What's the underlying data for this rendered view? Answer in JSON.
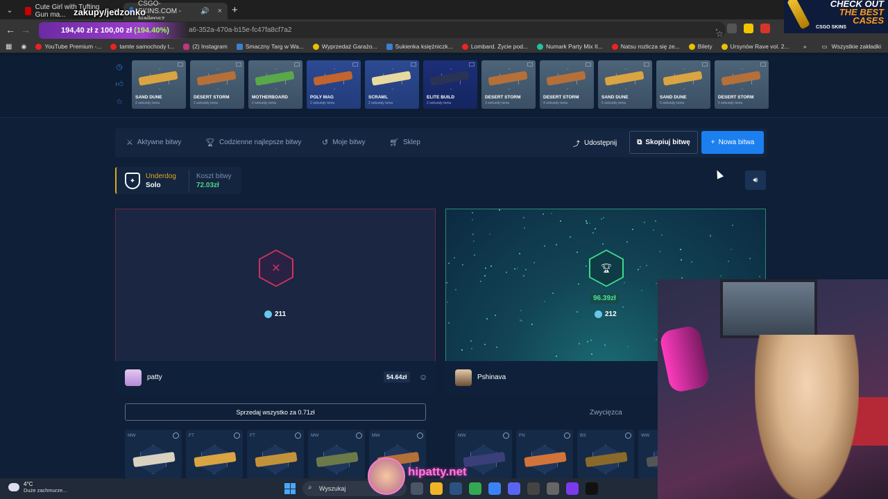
{
  "browser": {
    "tabs": [
      {
        "title": "Cute Girl with Tufting Gun ma...",
        "active": false
      },
      {
        "title": "CSGO-SKINS.COM - Najlepsz...",
        "active": true
      }
    ],
    "url": "a6-352a-470a-b15e-fc47fa8cf7a2",
    "bookmarks": [
      "YouTube Premium -...",
      "tamte samochody t...",
      "(2) Instagram",
      "Smaczny Targ w Wa...",
      "Wyprzedaż Garażo...",
      "Sukienka księżniczk...",
      "Lombard. Życie pod...",
      "Numark Party Mix II...",
      "Natsu rozlicza się ze...",
      "Bilety",
      "Ursynów Rave vol. 2..."
    ],
    "bookmarks_all": "Wszystkie zakładki"
  },
  "stream": {
    "title": "zakupy/jedzonko",
    "goal_current": "194,40 zł",
    "goal_mid": " z ",
    "goal_target": "100,00 zł",
    "goal_pct": "(194.40%)",
    "handle": "hipatty.net"
  },
  "ad": {
    "line1": "CHECK OUT",
    "line2": "THE BEST",
    "line3": "CASES",
    "logo": "CSGO SKINS"
  },
  "live_drops": [
    {
      "name": "SAND DUNE",
      "ago": "2 sekundy temu",
      "tier": "g",
      "color": "#d9a441"
    },
    {
      "name": "DESERT STORM",
      "ago": "2 sekundy temu",
      "tier": "g",
      "color": "#b5703a"
    },
    {
      "name": "MOTHERBOARD",
      "ago": "2 sekundy temu",
      "tier": "g",
      "color": "#5aa84a"
    },
    {
      "name": "POLY MAG",
      "ago": "2 sekundy temu",
      "tier": "b",
      "color": "#c2642f"
    },
    {
      "name": "SCRAWL",
      "ago": "2 sekundy temu",
      "tier": "b",
      "color": "#e8d9a0"
    },
    {
      "name": "ELITE BUILD",
      "ago": "2 sekundy temu",
      "tier": "dark",
      "color": "#2a3355"
    },
    {
      "name": "DESERT STORM",
      "ago": "3 sekundy temu",
      "tier": "g",
      "color": "#b5703a"
    },
    {
      "name": "DESERT STORM",
      "ago": "4 sekundy temu",
      "tier": "g",
      "color": "#b5703a"
    },
    {
      "name": "SAND DUNE",
      "ago": "5 sekundy temu",
      "tier": "g",
      "color": "#d9a441"
    },
    {
      "name": "SAND DUNE",
      "ago": "5 sekundy temu",
      "tier": "g",
      "color": "#d9a441"
    },
    {
      "name": "DESERT STORM",
      "ago": "5 sekundy temu",
      "tier": "g",
      "color": "#b5703a"
    }
  ],
  "menu": {
    "active": "Aktywne bitwy",
    "daily": "Codzienne najlepsze bitwy",
    "mine": "Moje bitwy",
    "shop": "Sklep",
    "share": "Udostępnij",
    "copy": "Skopiuj bitwę",
    "new": "Nowa bitwa"
  },
  "battle": {
    "mode_top": "Underdog",
    "mode_bottom": "Solo",
    "cost_label": "Koszt bitwy",
    "cost_value": "72.03zł"
  },
  "players": {
    "left": {
      "name": "patty",
      "value": "54.64zł",
      "coins": "211"
    },
    "right": {
      "name": "Pshinava",
      "win_amount": "96.39zł",
      "coins": "212"
    }
  },
  "actions": {
    "sell_all": "Sprzedaj wszystko za 0.71zł",
    "winner": "Zwycięzca"
  },
  "items_left": [
    {
      "wear": "MW",
      "color": "#d9d2c0"
    },
    {
      "wear": "FT",
      "color": "#d9a441"
    },
    {
      "wear": "FT",
      "color": "#c2923a"
    },
    {
      "wear": "MW",
      "color": "#6c7a4a"
    },
    {
      "wear": "MW",
      "color": "#b5703a"
    }
  ],
  "items_right": [
    {
      "wear": "MW",
      "color": "#3a3f7a"
    },
    {
      "wear": "FN",
      "color": "#d2743a"
    },
    {
      "wear": "BS",
      "color": "#8a6a2a"
    },
    {
      "wear": "WW",
      "color": "#555"
    }
  ],
  "taskbar": {
    "temp": "4°C",
    "weather": "Duże zachmurze...",
    "search": "Wyszukaj"
  }
}
